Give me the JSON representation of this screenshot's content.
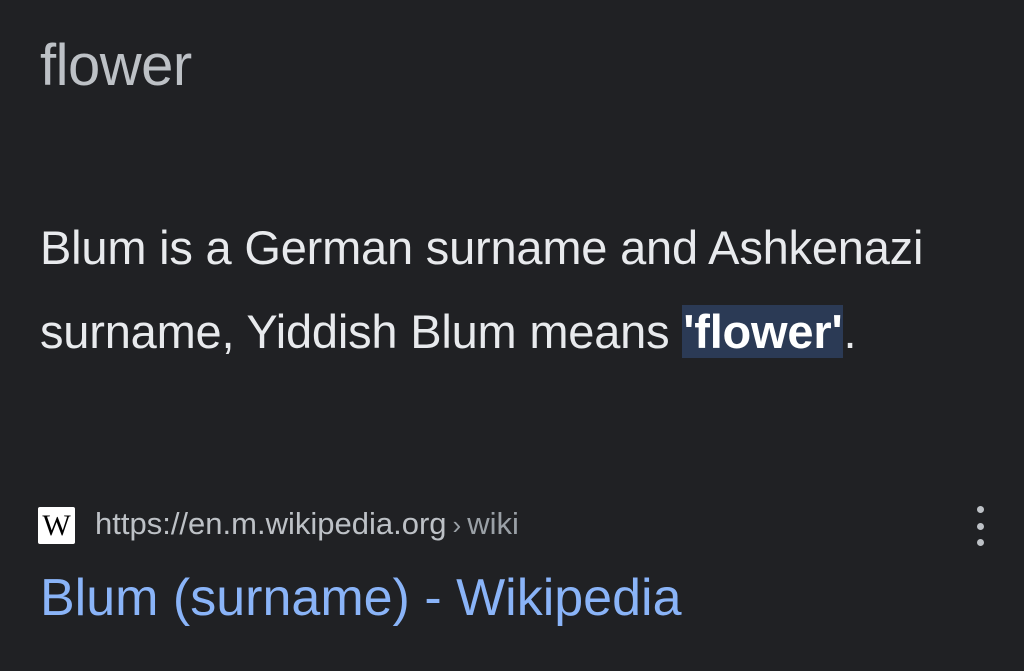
{
  "search": {
    "query": "flower"
  },
  "snippet": {
    "text_before": "Blum is a German surname and Ashkenazi surname, Yiddish Blum means ",
    "highlight": "'flower'",
    "text_after": "."
  },
  "result": {
    "favicon_glyph": "W",
    "url_domain": "https://en.m.wikipedia.org",
    "url_separator": "›",
    "url_path": "wiki",
    "title": "Blum (surname) - Wikipedia"
  },
  "colors": {
    "background": "#202124",
    "link": "#8ab4f8",
    "highlight_bg": "#2b3a55"
  },
  "icons": {
    "favicon": "wikipedia-icon",
    "more": "more-vert-icon"
  }
}
